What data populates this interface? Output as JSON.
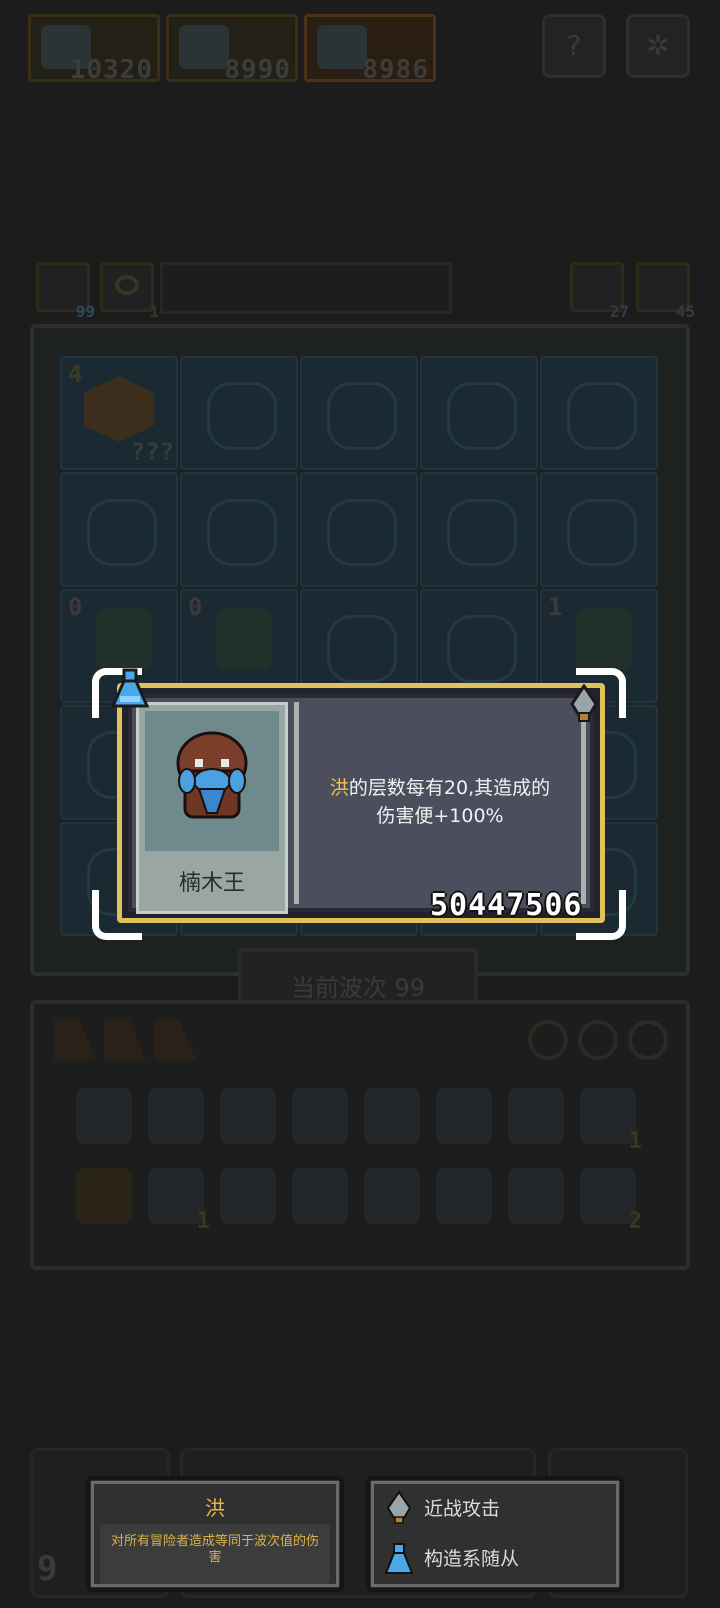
{
  "top_bar": {
    "heroes": [
      {
        "value": "10320"
      },
      {
        "value": "8990"
      },
      {
        "value": "8986"
      }
    ],
    "help_icon": "question-icon",
    "settings_icon": "gear-icon"
  },
  "stats_bar": {
    "left_count": "99",
    "eye_count": "1",
    "right_a_count": "27",
    "right_b_count": "45"
  },
  "board": {
    "cell_label_first": "4",
    "cell_unknown": "???",
    "cell_row3_a": "0",
    "cell_row3_b": "0",
    "cell_row3_e": "1"
  },
  "wave": {
    "label": "当前波次 99"
  },
  "inventory": {
    "item_count_a": "1",
    "item_count_b": "1",
    "item_count_c": "2"
  },
  "popup": {
    "name": "楠木王",
    "desc_highlight": "洪",
    "desc_rest": "的层数每有20,其造成的",
    "desc_line2": "伤害便+100%",
    "id_code": "50447506",
    "left_icon": "potion-icon",
    "right_icon": "spearhead-icon"
  },
  "bottom_cards": {
    "left_value": "9",
    "effect_card": {
      "title": "洪",
      "description": "对所有冒险者造成等同于波次值的伤害"
    },
    "tags_card": {
      "tags": [
        {
          "label": "近战攻击",
          "icon": "spearhead-icon"
        },
        {
          "label": "构造系随从",
          "icon": "potion-icon"
        }
      ]
    }
  },
  "colors": {
    "background": "#1c1c1c",
    "popup_border": "#e0c15a",
    "highlight": "#f1c24c",
    "potion": "#4aa8e8"
  }
}
